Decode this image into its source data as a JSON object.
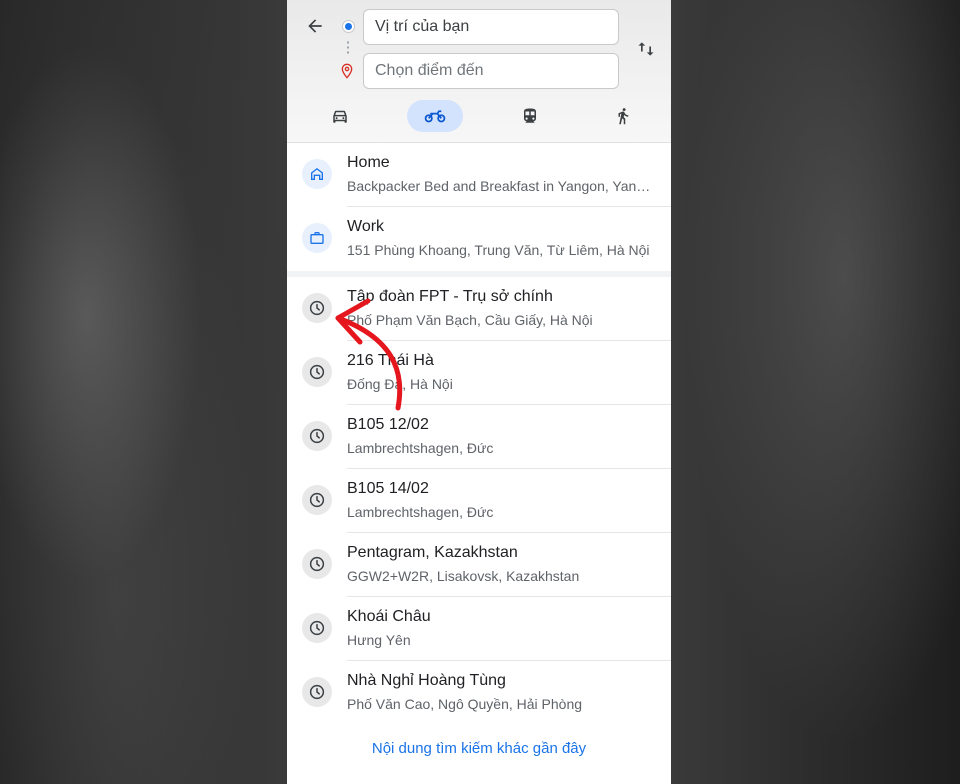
{
  "directions": {
    "origin_value": "Vị trí của bạn",
    "destination_placeholder": "Chọn điểm đến"
  },
  "modes": [
    {
      "name": "driving",
      "icon": "car-icon",
      "active": false
    },
    {
      "name": "motorbike",
      "icon": "motorbike-icon",
      "active": true
    },
    {
      "name": "transit",
      "icon": "train-icon",
      "active": false
    },
    {
      "name": "walking",
      "icon": "walk-icon",
      "active": false
    }
  ],
  "saved_places": [
    {
      "title": "Home",
      "subtitle": "Backpacker Bed and Breakfast in Yangon, Yangon",
      "icon": "home-icon"
    },
    {
      "title": "Work",
      "subtitle": "151 Phùng Khoang, Trung Văn, Từ Liêm, Hà Nội",
      "icon": "briefcase-icon"
    }
  ],
  "recent_places": [
    {
      "title": "Tập đoàn FPT - Trụ sở chính",
      "subtitle": "Phố Phạm Văn Bạch, Cầu Giấy, Hà Nội",
      "icon": "history-icon"
    },
    {
      "title": "216 Thái Hà",
      "subtitle": "Đống Đa, Hà Nội",
      "icon": "history-icon"
    },
    {
      "title": "B105 12/02",
      "subtitle": "Lambrechtshagen, Đức",
      "icon": "history-icon"
    },
    {
      "title": "B105 14/02",
      "subtitle": "Lambrechtshagen, Đức",
      "icon": "history-icon"
    },
    {
      "title": "Pentagram, Kazakhstan",
      "subtitle": "GGW2+W2R, Lisakovsk, Kazakhstan",
      "icon": "history-icon"
    },
    {
      "title": "Khoái Châu",
      "subtitle": "Hưng Yên",
      "icon": "history-icon"
    },
    {
      "title": "Nhà Nghỉ Hoàng Tùng",
      "subtitle": "Phố Văn Cao, Ngô Quyền, Hải Phòng",
      "icon": "history-icon"
    }
  ],
  "more_recent_label": "Nội dung tìm kiếm khác gần đây",
  "colors": {
    "accent": "#1a73e8",
    "active_mode_bg": "#d3e3fd",
    "annotation_arrow": "#e5161d"
  }
}
